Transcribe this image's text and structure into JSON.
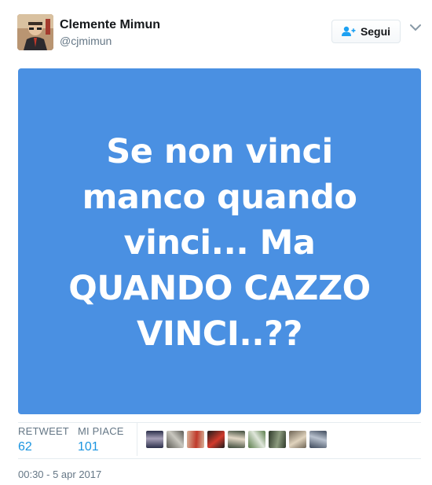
{
  "user": {
    "name": "Clemente Mimun",
    "handle": "@cjmimun"
  },
  "follow_button": {
    "label": "Segui",
    "icon": "add-user-icon"
  },
  "menu_caret_icon": "chevron-down-icon",
  "media": {
    "text": "Se non vinci\nmanco quando\nvinci... Ma\nQUANDO CAZZO\nVINCI..??",
    "background": "#4a90e2",
    "text_color": "#ffffff"
  },
  "stats": {
    "retweet_label": "RETWEET",
    "retweet_count": "62",
    "likes_label": "MI PIACE",
    "likes_count": "101"
  },
  "liker_avatars": [
    {
      "colors": [
        "#2b2f4a",
        "#a6a0b8"
      ]
    },
    {
      "colors": [
        "#5b5a54",
        "#c9c7bf"
      ]
    },
    {
      "colors": [
        "#d8b49a",
        "#c0392b"
      ]
    },
    {
      "colors": [
        "#1c1c1c",
        "#d33a2c"
      ]
    },
    {
      "colors": [
        "#3c4a3a",
        "#e3d8c6"
      ]
    },
    {
      "colors": [
        "#5a7d4a",
        "#dfe6da"
      ]
    },
    {
      "colors": [
        "#2f3a2a",
        "#8c9b7e"
      ]
    },
    {
      "colors": [
        "#6e6455",
        "#e0d3bd"
      ]
    },
    {
      "colors": [
        "#3e4a5c",
        "#b9c2cf"
      ]
    }
  ],
  "timestamp": "00:30 - 5 apr 2017",
  "colors": {
    "accent": "#1b95e0",
    "secondary_text": "#657786",
    "border": "#e6ecf0"
  }
}
